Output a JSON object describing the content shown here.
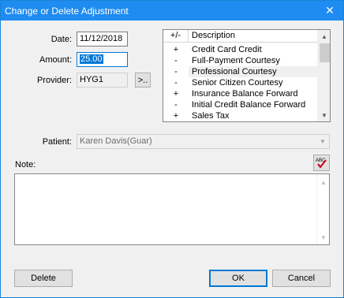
{
  "window": {
    "title": "Change or Delete Adjustment",
    "close_glyph": "✕"
  },
  "form": {
    "date_label": "Date:",
    "date_value": "11/12/2018",
    "amount_label": "Amount:",
    "amount_value": "25.00",
    "provider_label": "Provider:",
    "provider_value": "HYG1",
    "provider_button": ">..",
    "patient_label": "Patient:",
    "patient_value": "Karen  Davis(Guar)",
    "note_label": "Note:",
    "note_value": ""
  },
  "adjustment_list": {
    "columns": [
      "+/-",
      "Description"
    ],
    "rows": [
      {
        "sign": "+",
        "description": "Credit Card Credit"
      },
      {
        "sign": "-",
        "description": "Full-Payment Courtesy"
      },
      {
        "sign": "-",
        "description": "Professional Courtesy"
      },
      {
        "sign": "-",
        "description": "Senior Citizen Courtesy"
      },
      {
        "sign": "+",
        "description": "Insurance Balance Forward"
      },
      {
        "sign": "-",
        "description": "Initial Credit Balance Forward"
      },
      {
        "sign": "+",
        "description": "Sales Tax"
      }
    ],
    "selected_index": 2
  },
  "buttons": {
    "delete": "Delete",
    "ok": "OK",
    "cancel": "Cancel"
  },
  "icons": {
    "spell_check": "spell-check-icon",
    "spell_check_text": "ABC",
    "spell_check_mark": "✓"
  },
  "colors": {
    "title_bar": "#1e8cf0",
    "selection": "#0078d7",
    "spell_check_mark": "#c0001a"
  }
}
